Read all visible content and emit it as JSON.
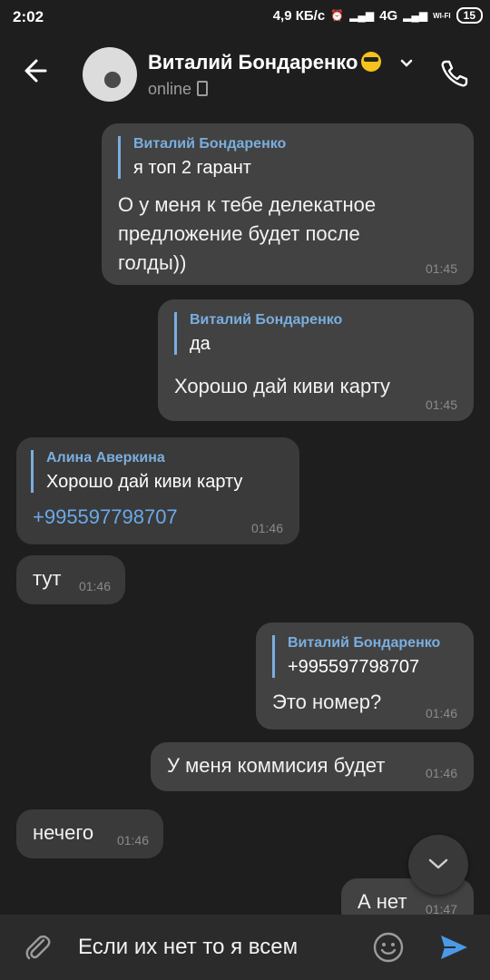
{
  "status_bar": {
    "time": "2:02",
    "network_speed": "4,9 КБ/с",
    "network_type": "4G",
    "wifi_label": "WI-FI",
    "battery": "15"
  },
  "header": {
    "contact_name": "Виталий Бондаренко",
    "status": "online"
  },
  "messages": [
    {
      "direction": "outgoing",
      "reply_name": "Виталий Бондаренко",
      "reply_text": "я топ 2 гарант",
      "lines": [
        "О у меня к тебе делекатное",
        "предложение будет после",
        "голды))"
      ],
      "time": "01:45"
    },
    {
      "direction": "outgoing",
      "reply_name": "Виталий Бондаренко",
      "reply_text": "да",
      "lines": [
        "Хорошо дай киви карту"
      ],
      "time": "01:45"
    },
    {
      "direction": "incoming",
      "reply_name": "Алина Аверкина",
      "reply_text": "Хорошо дай киви карту",
      "link": "+995597798707",
      "time": "01:46"
    },
    {
      "direction": "incoming",
      "text": "тут",
      "time": "01:46"
    },
    {
      "direction": "outgoing",
      "reply_name": "Виталий Бондаренко",
      "reply_text": "+995597798707",
      "lines": [
        "Это номер?"
      ],
      "time": "01:46"
    },
    {
      "direction": "outgoing",
      "text": "У меня коммисия будет",
      "time": "01:46"
    },
    {
      "direction": "incoming",
      "text": "нечего",
      "time": "01:46"
    },
    {
      "direction": "outgoing",
      "text": "А нет",
      "time": "01:47"
    }
  ],
  "composer": {
    "draft": "Если их нет то я всем"
  },
  "colors": {
    "background": "#1e1e1e",
    "bubble_incoming": "#3a3a3a",
    "bubble_outgoing": "#424242",
    "accent": "#7aaede",
    "send": "#4a9ae8"
  },
  "icons": [
    "back-arrow-icon",
    "chevron-down-icon",
    "phone-call-icon",
    "scroll-down-icon",
    "paperclip-icon",
    "emoji-icon",
    "send-icon"
  ]
}
